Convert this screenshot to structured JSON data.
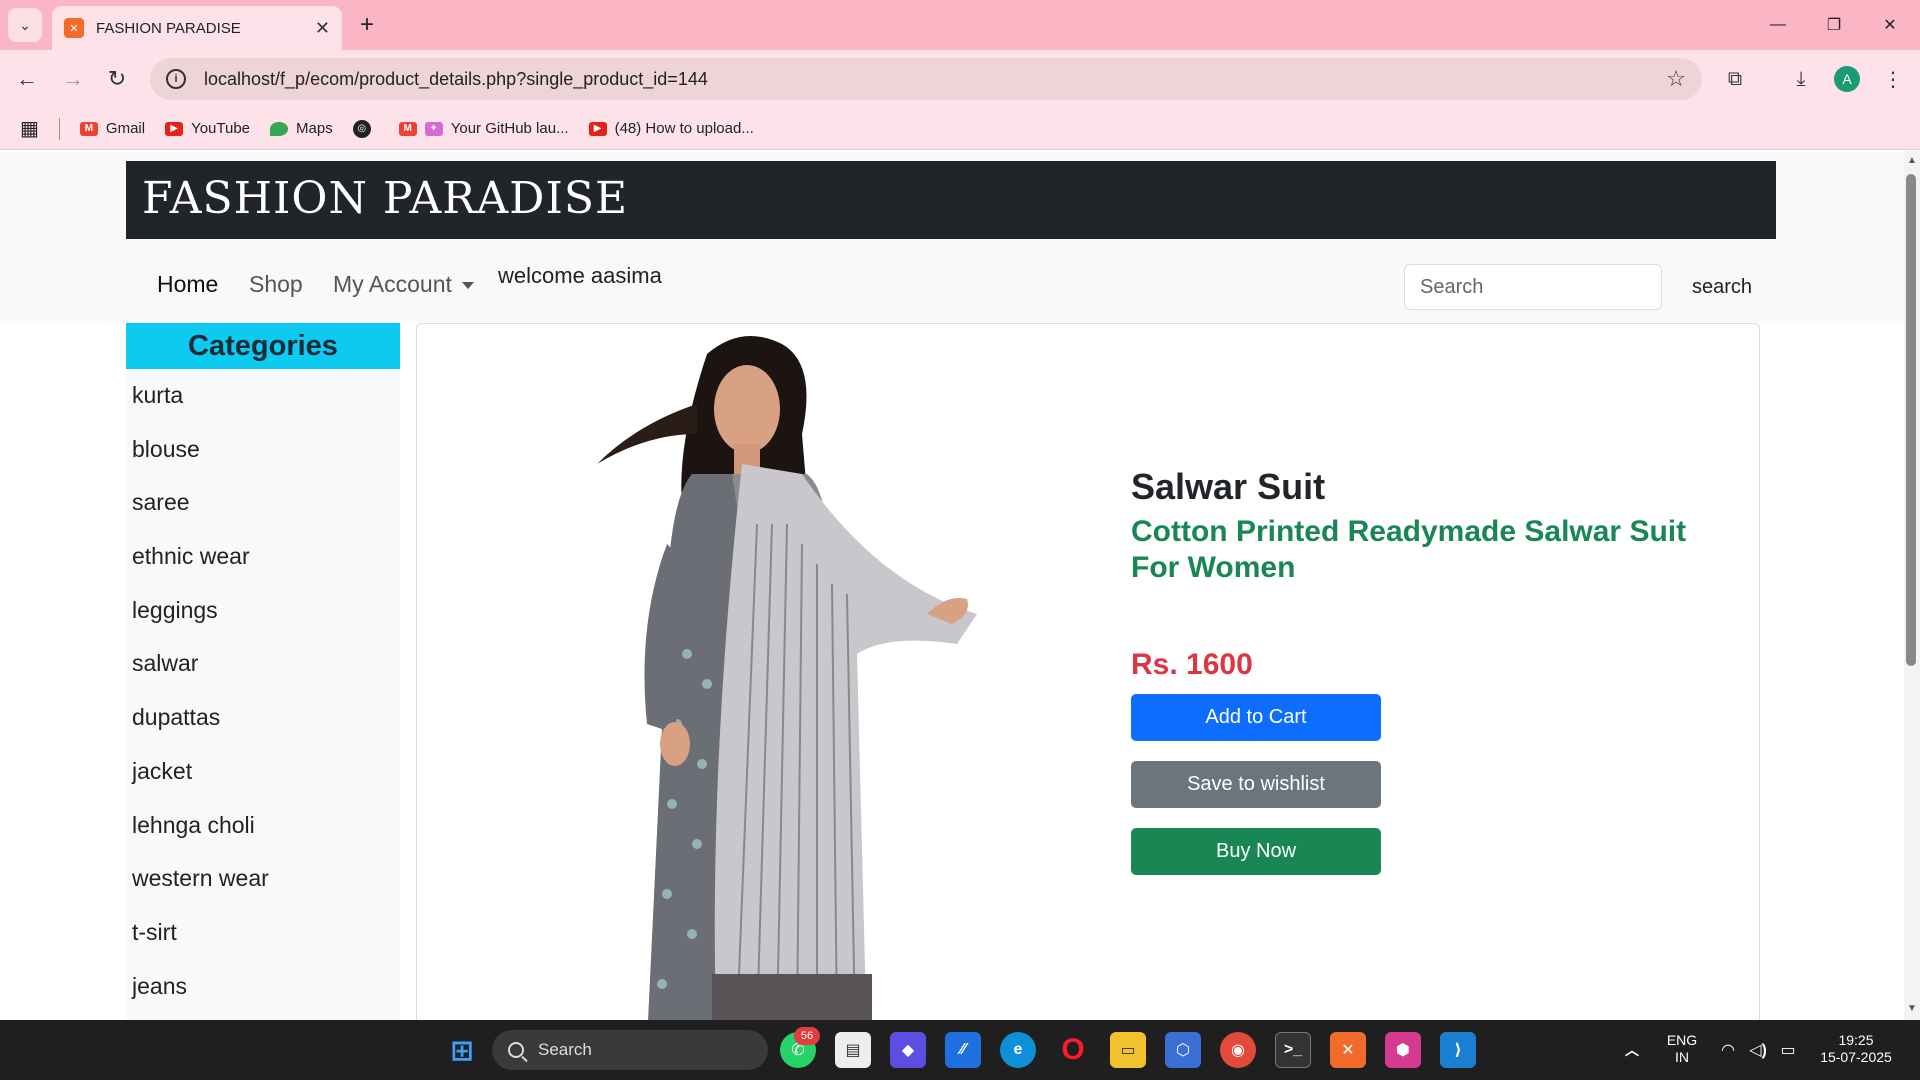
{
  "browser": {
    "tab_title": "FASHION PARADISE",
    "tab_favicon": "xampp-icon",
    "url": "localhost/f_p/ecom/product_details.php?single_product_id=144",
    "bookmarks": [
      {
        "label": "Gmail",
        "icon": "gmail-icon"
      },
      {
        "label": "YouTube",
        "icon": "youtube-icon"
      },
      {
        "label": "Maps",
        "icon": "maps-icon"
      },
      {
        "label": "",
        "icon": "globe-icon"
      },
      {
        "label": "Your GitHub lau...",
        "icon": "github-launch-icon"
      },
      {
        "label": "(48) How to upload...",
        "icon": "youtube-icon"
      }
    ],
    "profile_initial": "A",
    "colors": {
      "tabbar": "#fbb6c6",
      "toolbar": "#fde3e9"
    }
  },
  "site": {
    "brand": "FASHION PARADISE",
    "nav": {
      "home": "Home",
      "shop": "Shop",
      "account": "My Account",
      "welcome": "welcome aasima",
      "search_placeholder": "Search",
      "search_button": "search"
    },
    "categories": {
      "heading": "Categories",
      "items": [
        "kurta",
        "blouse",
        "saree",
        "ethnic wear",
        "leggings",
        "salwar",
        "dupattas",
        "jacket",
        "lehnga choli",
        "western wear",
        "t-sirt",
        "jeans"
      ]
    },
    "product": {
      "title": "Salwar Suit",
      "description": "Cotton Printed Readymade Salwar Suit For Women",
      "price": "Rs. 1600",
      "add_to_cart": "Add to Cart",
      "save_wishlist": "Save to wishlist",
      "buy_now": "Buy Now"
    },
    "colors": {
      "brand_bar": "#212529",
      "categories_head": "#0dcaf0",
      "price": "#dc3545",
      "desc": "#198754",
      "primary": "#0d6efd",
      "secondary": "#6c757d",
      "success": "#198754"
    }
  },
  "taskbar": {
    "search_label": "Search",
    "whatsapp_badge": "56",
    "lang_line1": "ENG",
    "lang_line2": "IN",
    "time": "19:25",
    "date": "15-07-2025"
  }
}
